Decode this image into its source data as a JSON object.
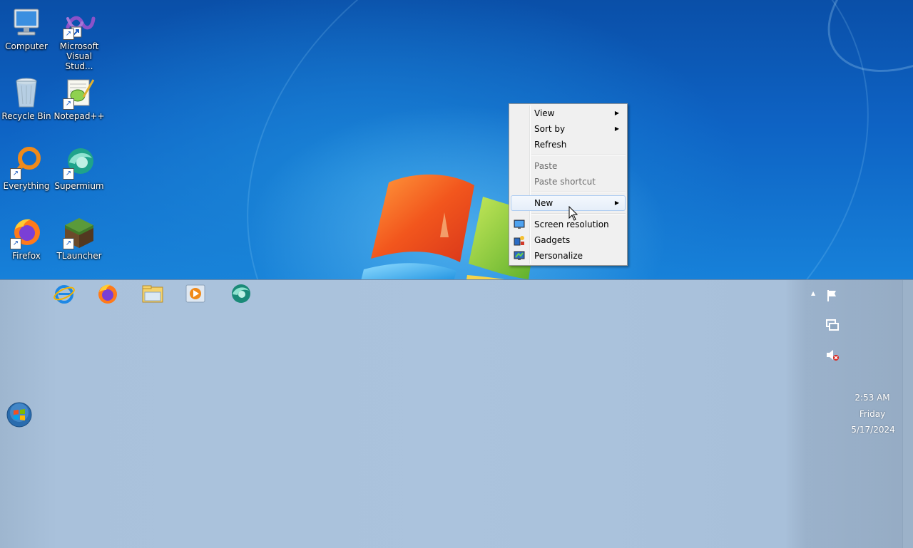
{
  "desktop": {
    "icons": [
      {
        "label": "Computer",
        "icon": "computer-icon"
      },
      {
        "label": "Microsoft Visual Stud...",
        "icon": "visual-studio-icon"
      },
      {
        "label": "Recycle Bin",
        "icon": "recycle-bin-icon"
      },
      {
        "label": "Notepad++",
        "icon": "notepad-plus-plus-icon"
      },
      {
        "label": "Everything",
        "icon": "everything-icon"
      },
      {
        "label": "Supermium",
        "icon": "supermium-icon"
      },
      {
        "label": "Firefox",
        "icon": "firefox-icon"
      },
      {
        "label": "TLauncher",
        "icon": "tlauncher-icon"
      }
    ]
  },
  "context_menu": {
    "items": [
      {
        "label": "View",
        "submenu": true
      },
      {
        "label": "Sort by",
        "submenu": true
      },
      {
        "label": "Refresh"
      },
      {
        "label": "Paste",
        "disabled": true
      },
      {
        "label": "Paste shortcut",
        "disabled": true
      },
      {
        "label": "New",
        "submenu": true,
        "highlighted": true
      },
      {
        "label": "Screen resolution",
        "icon": "screen-resolution-icon"
      },
      {
        "label": "Gadgets",
        "icon": "gadgets-icon"
      },
      {
        "label": "Personalize",
        "icon": "personalize-icon"
      }
    ],
    "submenu_arrow": "▶"
  },
  "taskbar": {
    "pinned": [
      {
        "icon": "internet-explorer-icon"
      },
      {
        "icon": "firefox-icon"
      },
      {
        "icon": "file-explorer-icon"
      },
      {
        "icon": "media-player-icon"
      },
      {
        "icon": "supermium-icon"
      }
    ],
    "tray": {
      "show_hidden_arrow": "▲",
      "icons": [
        "action-center-flag-icon",
        "network-icon",
        "volume-muted-icon"
      ]
    },
    "clock": {
      "time": "2:53 AM",
      "day": "Friday",
      "date": "5/17/2024"
    }
  },
  "colors": {
    "desktop_blue": "#0e63c4",
    "taskbar": "#abc3dd",
    "menu_bg": "#f0f0f0",
    "menu_highlight_border": "#aeccf1"
  }
}
